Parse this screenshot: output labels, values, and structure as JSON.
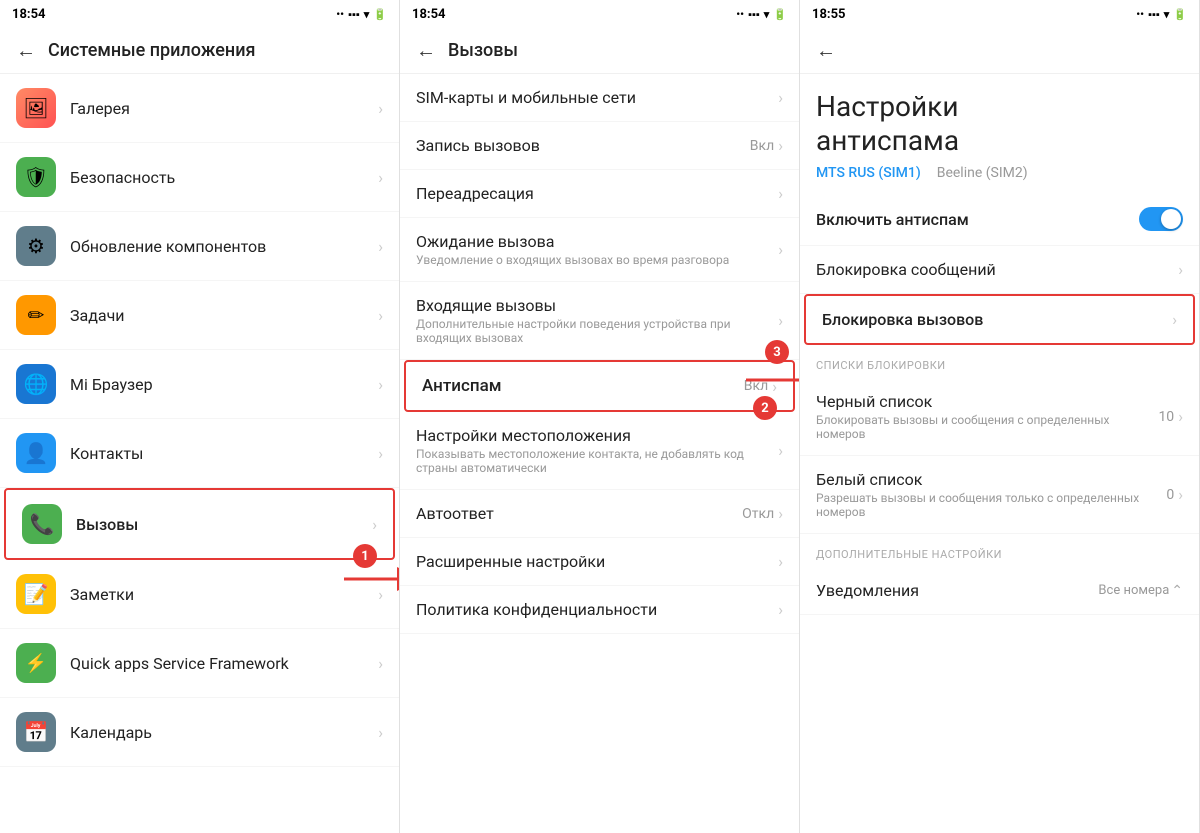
{
  "panel1": {
    "statusBar": {
      "time": "18:54",
      "dots": "••"
    },
    "header": {
      "back": "←",
      "title": "Системные приложения"
    },
    "items": [
      {
        "id": "gallery",
        "icon": "🖼",
        "iconClass": "icon-gallery",
        "title": "Галерея",
        "subtitle": ""
      },
      {
        "id": "security",
        "icon": "🛡",
        "iconClass": "icon-security",
        "title": "Безопасность",
        "subtitle": ""
      },
      {
        "id": "update",
        "icon": "⚙",
        "iconClass": "icon-update",
        "title": "Обновление компонентов",
        "subtitle": ""
      },
      {
        "id": "tasks",
        "icon": "✏",
        "iconClass": "icon-tasks",
        "title": "Задачи",
        "subtitle": ""
      },
      {
        "id": "browser",
        "icon": "🌐",
        "iconClass": "icon-browser",
        "title": "Mi Браузер",
        "subtitle": ""
      },
      {
        "id": "contacts",
        "icon": "👤",
        "iconClass": "icon-contacts",
        "title": "Контакты",
        "subtitle": ""
      },
      {
        "id": "calls",
        "icon": "📞",
        "iconClass": "icon-calls",
        "title": "Вызовы",
        "subtitle": "",
        "highlighted": true,
        "step": "1"
      },
      {
        "id": "notes",
        "icon": "📝",
        "iconClass": "icon-notes",
        "title": "Заметки",
        "subtitle": ""
      },
      {
        "id": "quick",
        "icon": "⚡",
        "iconClass": "icon-quick",
        "title": "Quick apps Service Framework",
        "subtitle": ""
      },
      {
        "id": "calendar",
        "icon": "📅",
        "iconClass": "icon-calendar",
        "title": "Календарь",
        "subtitle": ""
      }
    ]
  },
  "panel2": {
    "statusBar": {
      "time": "18:54",
      "dots": "••"
    },
    "header": {
      "back": "←",
      "title": "Вызовы"
    },
    "items": [
      {
        "id": "sim",
        "title": "SIM-карты и мобильные сети",
        "subtitle": "",
        "value": ""
      },
      {
        "id": "record",
        "title": "Запись вызовов",
        "subtitle": "",
        "value": "Вкл"
      },
      {
        "id": "forward",
        "title": "Переадресация",
        "subtitle": "",
        "value": ""
      },
      {
        "id": "waiting",
        "title": "Ожидание вызова",
        "subtitle": "Уведомление о входящих вызовах во время разговора",
        "value": ""
      },
      {
        "id": "incoming",
        "title": "Входящие вызовы",
        "subtitle": "Дополнительные настройки поведения устройства при входящих вызовах",
        "value": ""
      },
      {
        "id": "antispam",
        "title": "Антиспам",
        "subtitle": "",
        "value": "Вкл",
        "highlighted": true,
        "step": "2"
      },
      {
        "id": "location",
        "title": "Настройки местоположения",
        "subtitle": "Показывать местоположение контакта, не добавлять код страны автоматически",
        "value": ""
      },
      {
        "id": "autoanswer",
        "title": "Автоответ",
        "subtitle": "",
        "value": "Откл"
      },
      {
        "id": "advanced",
        "title": "Расширенные настройки",
        "subtitle": "",
        "value": ""
      },
      {
        "id": "privacy",
        "title": "Политика конфиденциальности",
        "subtitle": "",
        "value": ""
      }
    ]
  },
  "panel3": {
    "statusBar": {
      "time": "18:55",
      "dots": "••"
    },
    "header": {
      "back": "←"
    },
    "title": "Настройки\nантиспама",
    "simTabs": [
      {
        "id": "sim1",
        "label": "MTS RUS (SIM1)",
        "active": true
      },
      {
        "id": "sim2",
        "label": "Beeline (SIM2)",
        "active": false
      }
    ],
    "toggleRow": {
      "label": "Включить антиспам",
      "enabled": true
    },
    "items": [
      {
        "id": "blockMessages",
        "title": "Блокировка сообщений",
        "subtitle": "",
        "value": "",
        "highlighted": false
      },
      {
        "id": "blockCalls",
        "title": "Блокировка вызовов",
        "subtitle": "",
        "value": "",
        "highlighted": true,
        "step": "3"
      }
    ],
    "blockSection": {
      "label": "СПИСКИ БЛОКИРОВКИ",
      "items": [
        {
          "id": "blacklist",
          "title": "Черный список",
          "subtitle": "Блокировать вызовы и сообщения с определенных номеров",
          "count": "10"
        },
        {
          "id": "whitelist",
          "title": "Белый список",
          "subtitle": "Разрешать вызовы и сообщения только с определенных номеров",
          "count": "0"
        }
      ]
    },
    "additionalSection": {
      "label": "ДОПОЛНИТЕЛЬНЫЕ НАСТРОЙКИ",
      "items": [
        {
          "id": "notifications",
          "title": "Уведомления",
          "value": "Все номера"
        }
      ]
    }
  },
  "arrows": {
    "color": "#e53935"
  }
}
